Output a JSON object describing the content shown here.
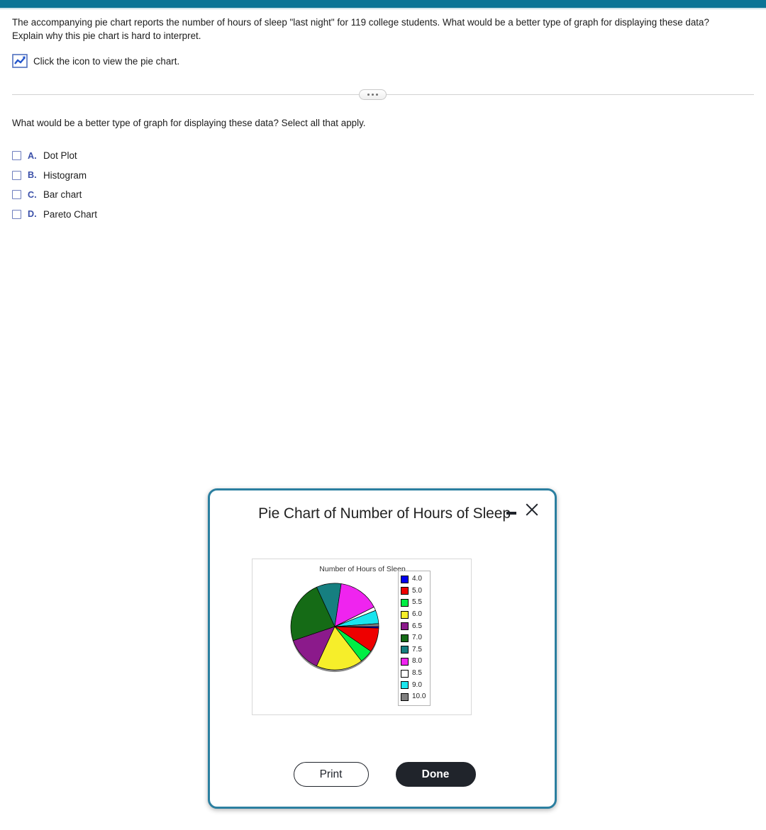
{
  "theme": {
    "accent_bar_color": "#0b7496",
    "dialog_border_color": "#2b7fa0",
    "option_letter_color": "#3a4fa8",
    "done_button_color": "#20242b"
  },
  "problem": {
    "stem": "The accompanying pie chart reports the number of hours of sleep \"last night\" for 119 college students. What would be a better type of graph for displaying these data? Explain why this pie chart is hard to interpret.",
    "icon_name": "line-chart-icon",
    "icon_link_text": "Click the icon to view the pie chart.",
    "ellipsis_label": "..."
  },
  "question": {
    "prompt": "What would be a better type of graph for displaying these data? Select all that apply.",
    "options": [
      {
        "letter": "A.",
        "label": "Dot Plot",
        "checked": false
      },
      {
        "letter": "B.",
        "label": "Histogram",
        "checked": false
      },
      {
        "letter": "C.",
        "label": "Bar chart",
        "checked": false
      },
      {
        "letter": "D.",
        "label": "Pareto Chart",
        "checked": false
      }
    ]
  },
  "dialog": {
    "title": "Pie Chart of Number of Hours of Sleep",
    "minimize_icon": "minimize-icon",
    "close_icon": "close-icon",
    "print_label": "Print",
    "done_label": "Done"
  },
  "chart_data": {
    "type": "pie",
    "title": "Number of Hours of Sleep",
    "xlabel": "",
    "ylabel": "",
    "legend_position": "right",
    "total_observations": 119,
    "categories": [
      "4.0",
      "5.0",
      "5.5",
      "6.0",
      "6.5",
      "7.0",
      "7.5",
      "8.0",
      "8.5",
      "9.0",
      "10.0"
    ],
    "colors": [
      "#0000ee",
      "#ee0000",
      "#00ee44",
      "#f6ee2a",
      "#8b1a8b",
      "#156b16",
      "#167f80",
      "#ef24ef",
      "#ffffff",
      "#1ae5ee",
      "#808080"
    ],
    "values": [
      1,
      11,
      6,
      20,
      15,
      28,
      11,
      18,
      2,
      6,
      1
    ],
    "angles_deg": [
      2,
      33,
      18,
      62,
      47,
      85,
      33,
      55,
      5,
      18,
      4
    ],
    "start_angle_deg": 0,
    "direction": "clockwise",
    "legend_entries": [
      {
        "label": "4.0",
        "color": "#0000ee"
      },
      {
        "label": "5.0",
        "color": "#ee0000"
      },
      {
        "label": "5.5",
        "color": "#00ee44"
      },
      {
        "label": "6.0",
        "color": "#f6ee2a"
      },
      {
        "label": "6.5",
        "color": "#8b1a8b"
      },
      {
        "label": "7.0",
        "color": "#156b16"
      },
      {
        "label": "7.5",
        "color": "#167f80"
      },
      {
        "label": "8.0",
        "color": "#ef24ef"
      },
      {
        "label": "8.5",
        "color": "#ffffff"
      },
      {
        "label": "9.0",
        "color": "#1ae5ee"
      },
      {
        "label": "10.0",
        "color": "#808080"
      }
    ]
  }
}
